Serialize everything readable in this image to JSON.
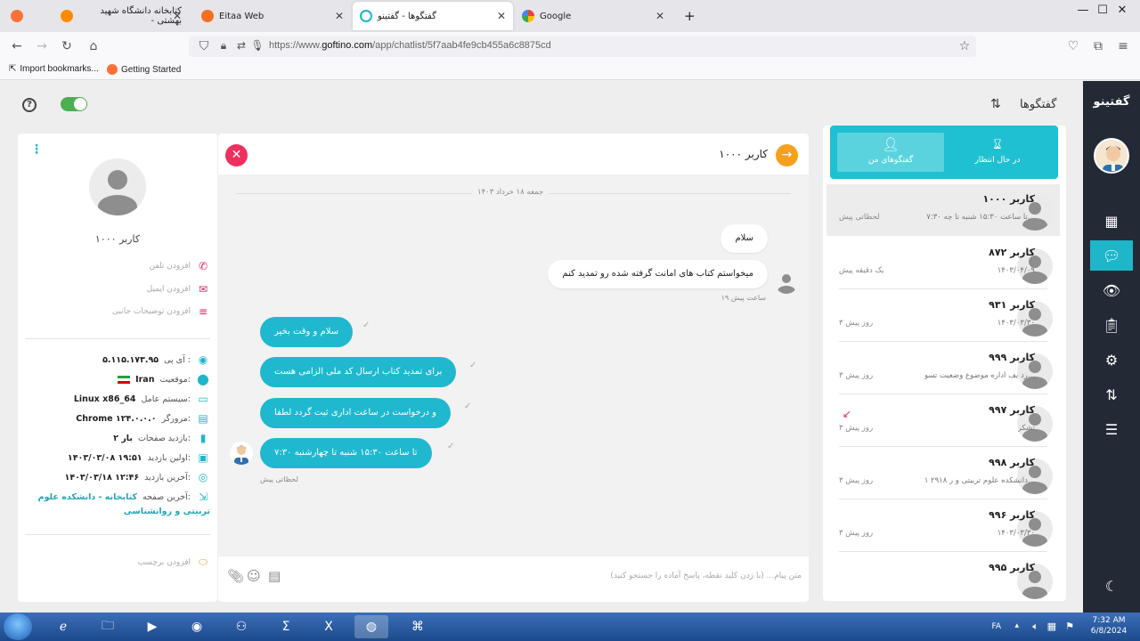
{
  "browser": {
    "tabs": [
      {
        "label": "کتابخانه دانشگاه شهید بهشتی -",
        "icon": "firefox-icon",
        "color": "#ff8a00"
      },
      {
        "label": "Eitaa Web",
        "icon": "eitaa-icon",
        "color": "#f37021"
      },
      {
        "label": "گفتگوها - گفتینو",
        "icon": "goftino-icon",
        "color": "#1fb6c9"
      },
      {
        "label": "Google",
        "icon": "google-icon",
        "color": "#4285f4"
      }
    ],
    "new_tab": "+",
    "url_prefix": "https://www.",
    "url_domain": "goftino.com",
    "url_path": "/app/chatlist/5f7aab4fe9cb455a6c8875cd",
    "bookmarks": [
      "Import bookmarks...",
      "Getting Started"
    ]
  },
  "app": {
    "brand": "گفتینو",
    "conversations_title": "گفتگوها",
    "list_tabs": [
      {
        "label": "در حال انتظار",
        "icon": "hourglass-icon"
      },
      {
        "label": "گفتگوهای من",
        "icon": "person-icon"
      }
    ],
    "conversations": [
      {
        "name": "کاربر ۱۰۰۰",
        "preview": "۷:۳۰ تا ساعت ۱۵:۳۰ شنبه تا چه...",
        "time": "لحظاتی پیش"
      },
      {
        "name": "کاربر ۸۷۲",
        "preview": "۱۴۰۳/۰۴/۰۹",
        "time": "یک دقیقه پیش"
      },
      {
        "name": "کاربر ۹۳۱",
        "preview": "۱۴۰۳/۰۳/۳۰",
        "time": "۳ روز پیش"
      },
      {
        "name": "کاربر ۹۹۹",
        "preview": "رد یف اداره موضوع وضعیت تسو...",
        "time": "۳ روز پیش"
      },
      {
        "name": "کاربر ۹۹۷",
        "preview": "تشکر",
        "time": "۳ روز پیش"
      },
      {
        "name": "کاربر ۹۹۸",
        "preview": "۱ ۲۹۱۸ دانشکده علوم تربیتی و ر...",
        "time": "۳ روز پیش"
      },
      {
        "name": "کاربر ۹۹۶",
        "preview": "۱۴۰۳/۰۳/۳۰",
        "time": "۳ روز پیش"
      },
      {
        "name": "کاربر ۹۹۵",
        "preview": "",
        "time": ""
      }
    ],
    "chat": {
      "name": "کاربر ۱۰۰۰",
      "day": "جمعه ۱۸ خرداد ۱۴۰۳",
      "incoming": [
        {
          "text": "سلام"
        },
        {
          "text": "میخواستم کتاب های امانت گرفته شده رو تمدید کنم"
        }
      ],
      "incoming_time": "۱۹ ساعت پیش",
      "outgoing": [
        {
          "text": "سلام و وقت بخیر"
        },
        {
          "text": "برای تمدید کتاب ارسال کد ملی الزامی هست"
        },
        {
          "text": "و درخواست در ساعت اداری ثبت گردد لطفا"
        },
        {
          "text": "۷:۳۰ تا ساعت ۱۵:۳۰ شنبه تا چهارشنبه"
        }
      ],
      "outgoing_time": "لحظاتی پیش",
      "input_placeholder": "متن پیام... (با زدن کلید نقطه، پاسخ آماده را جستجو کنید)"
    },
    "profile": {
      "name": "کاربر ۱۰۰۰",
      "add_phone": "افزودن تلفن",
      "add_email": "افزودن ایمیل",
      "add_notes": "افزودن توضیحات جانبی",
      "ip_label": "آی پی :",
      "ip_value": "۵.۱۱۵.۱۷۳.۹۵",
      "location_label": "موقعیت:",
      "location_value": "Iran",
      "os_label": "سیستم عامل:",
      "os_value": "Linux x86_64",
      "browser_label": "مرورگر:",
      "browser_value": "Chrome ۱۲۴.۰.۰.۰",
      "visits_label": "بازدید صفحات:",
      "visits_value": "۲ بار",
      "first_visit_label": "اولین بازدید:",
      "first_visit_value": "۱۴۰۳/۰۳/۰۸ ۱۹:۵۱",
      "last_visit_label": "آخرین بازدید:",
      "last_visit_value": "۱۴۰۳/۰۳/۱۸ ۱۲:۴۶",
      "last_page_label": "آخرین صفحه:",
      "last_page_value": "کتابخانه - دانشکده علوم",
      "last_page_value2": "تربیتی و روانشناسی",
      "add_tag": "افزودن برچسب"
    }
  },
  "taskbar": {
    "lang": "FA",
    "time": "7:32 AM",
    "date": "6/8/2024"
  }
}
